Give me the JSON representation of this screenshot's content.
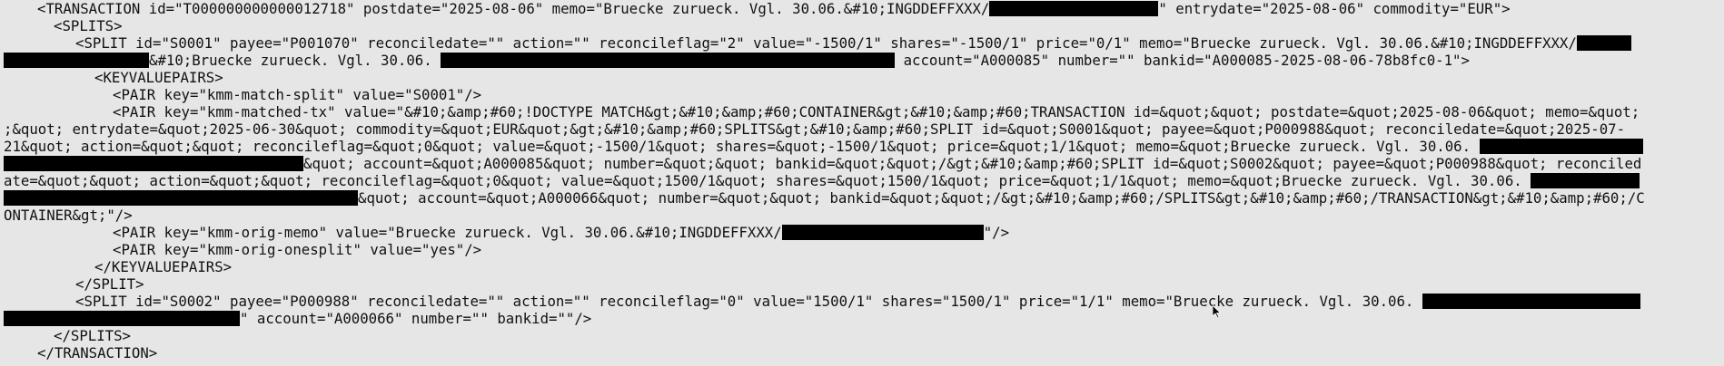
{
  "xml": {
    "l01a": "<TRANSACTION id=\"T000000000000012718\" postdate=\"2025-08-06\" memo=\"Bruecke zurueck. Vgl. 30.06.&#10;INGDDEFFXXX/",
    "l01b": "\" entrydate=\"2025-08-06\" commodity=\"EUR\">",
    "l02": "<SPLITS>",
    "l03": "<SPLIT id=\"S0001\" payee=\"P001070\" reconciledate=\"\" action=\"\" reconcileflag=\"2\" value=\"-1500/1\" shares=\"-1500/1\" price=\"0/1\" memo=\"Bruecke zurueck. Vgl. 30.06.&#10;INGDDEFFXXX/",
    "l04a": "&#10;Bruecke zurueck. Vgl. 30.06. ",
    "l04b": " account=\"A000085\" number=\"\" bankid=\"A000085-2025-08-06-78b8fc0-1\">",
    "l05": "<KEYVALUEPAIRS>",
    "l06": "<PAIR key=\"kmm-match-split\" value=\"S0001\"/>",
    "l07": "<PAIR key=\"kmm-matched-tx\" value=\"&#10;&amp;#60;!DOCTYPE MATCH&gt;&#10;&amp;#60;CONTAINER&gt;&#10;&amp;#60;TRANSACTION id=&quot;&quot; postdate=&quot;2025-08-06&quot; memo=&quot;",
    "l08": ";&quot; entrydate=&quot;2025-06-30&quot; commodity=&quot;EUR&quot;&gt;&#10;&amp;#60;SPLITS&gt;&#10;&amp;#60;SPLIT id=&quot;S0001&quot; payee=&quot;P000988&quot; reconciledate=&quot;2025-07-",
    "l09": "21&quot; action=&quot;&quot; reconcileflag=&quot;0&quot; value=&quot;-1500/1&quot; shares=&quot;-1500/1&quot; price=&quot;1/1&quot; memo=&quot;Bruecke zurueck. Vgl. 30.06.",
    "l10": "&quot; account=&quot;A000085&quot; number=&quot;&quot; bankid=&quot;&quot;/&gt;&#10;&amp;#60;SPLIT id=&quot;S0002&quot; payee=&quot;P000988&quot; reconciled",
    "l11": "ate=&quot;&quot; action=&quot;&quot; reconcileflag=&quot;0&quot; value=&quot;1500/1&quot; shares=&quot;1500/1&quot; price=&quot;1/1&quot; memo=&quot;Bruecke zurueck. Vgl. 30.06.",
    "l12": "&quot; account=&quot;A000066&quot; number=&quot;&quot; bankid=&quot;&quot;/&gt;&#10;&amp;#60;/SPLITS&gt;&#10;&amp;#60;/TRANSACTION&gt;&#10;&amp;#60;/C",
    "l13": "ONTAINER&gt;\"/>",
    "l14a": "<PAIR key=\"kmm-orig-memo\" value=\"Bruecke zurueck. Vgl. 30.06.&#10;INGDDEFFXXX/",
    "l14b": "\"/>",
    "l15": "<PAIR key=\"kmm-orig-onesplit\" value=\"yes\"/>",
    "l16": "</KEYVALUEPAIRS>",
    "l17": "</SPLIT>",
    "l18": "<SPLIT id=\"S0002\" payee=\"P000988\" reconciledate=\"\" action=\"\" reconcileflag=\"0\" value=\"1500/1\" shares=\"1500/1\" price=\"1/1\" memo=\"Bruecke zurueck. Vgl. 30.06.",
    "l19": "\" account=\"A000066\" number=\"\" bankid=\"\"/>",
    "l20": "</SPLITS>",
    "l21": "</TRANSACTION>"
  },
  "colors": {
    "background": "#e6e6e6",
    "text": "#111111",
    "redaction": "#000000"
  },
  "cursor": {
    "icon": "mouse-pointer-icon"
  }
}
